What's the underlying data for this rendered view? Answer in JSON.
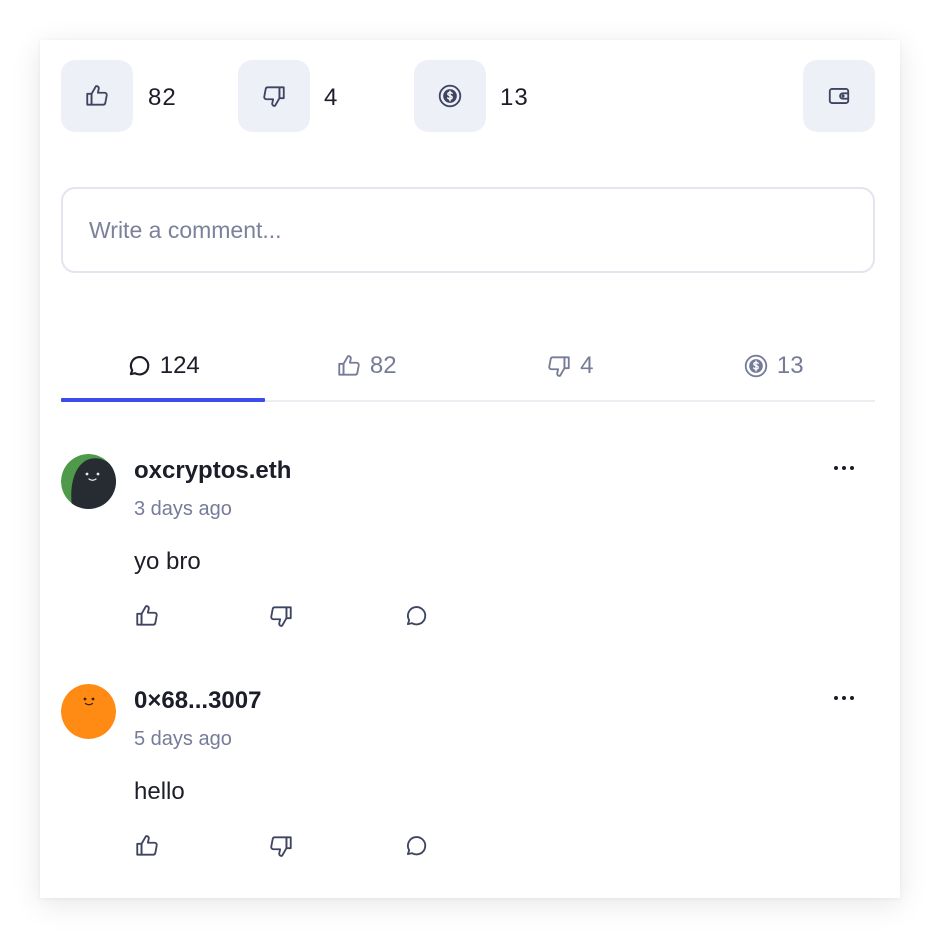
{
  "reactions": {
    "likes": "82",
    "dislikes": "4",
    "tips": "13"
  },
  "comment_input": {
    "placeholder": "Write a comment...",
    "value": ""
  },
  "tabs": [
    {
      "icon": "chat-bubble-icon",
      "label": "124",
      "active": true
    },
    {
      "icon": "thumbs-up-icon",
      "label": "82",
      "active": false
    },
    {
      "icon": "thumbs-down-icon",
      "label": "4",
      "active": false
    },
    {
      "icon": "dollar-coin-icon",
      "label": "13",
      "active": false
    }
  ],
  "comments": [
    {
      "author": "oxcryptos.eth",
      "time": "3 days ago",
      "text": "yo bro",
      "avatar": "dark-avatar"
    },
    {
      "author": "0×68...3007",
      "time": "5 days ago",
      "text": "hello",
      "avatar": "orange-avatar"
    }
  ],
  "colors": {
    "accent": "#3b4ce8",
    "icon": "#3f4560",
    "muted_text": "#767c98",
    "button_bg": "#eef0f8",
    "avatar_orange": "#ff8a14",
    "avatar_dark": "#272c33",
    "avatar_green": "#4e9a4a"
  }
}
